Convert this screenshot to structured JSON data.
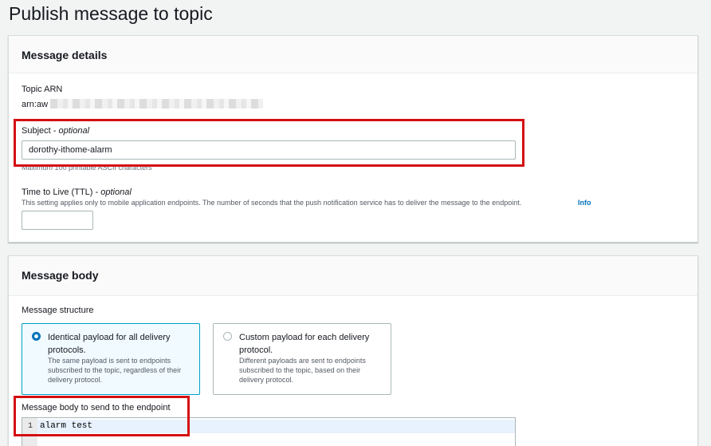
{
  "page": {
    "title": "Publish message to topic"
  },
  "message_details": {
    "heading": "Message details",
    "topic_arn_label": "Topic ARN",
    "topic_arn_value": "arn:aw",
    "subject_label": "Subject",
    "subject_optional": "optional",
    "subject_value": "dorothy-ithome-alarm",
    "subject_hint": "Maximum 100 printable ASCII characters",
    "ttl_label": "Time to Live (TTL)",
    "ttl_optional": "optional",
    "ttl_description": "This setting applies only to mobile application endpoints. The number of seconds that the push notification service has to deliver the message to the endpoint.",
    "ttl_info": "Info",
    "ttl_value": ""
  },
  "message_body": {
    "heading": "Message body",
    "structure_label": "Message structure",
    "option_identical_title": "Identical payload for all delivery protocols.",
    "option_identical_desc": "The same payload is sent to endpoints subscribed to the topic, regardless of their delivery protocol.",
    "option_custom_title": "Custom payload for each delivery protocol.",
    "option_custom_desc": "Different payloads are sent to endpoints subscribed to the topic, based on their delivery protocol.",
    "selected_option": "identical",
    "body_label": "Message body to send to the endpoint",
    "editor_line_number": "1",
    "editor_text": "alarm test"
  },
  "colors": {
    "highlight": "#d40f12",
    "accent": "#0073bb",
    "selected_border": "#00a1c9"
  }
}
